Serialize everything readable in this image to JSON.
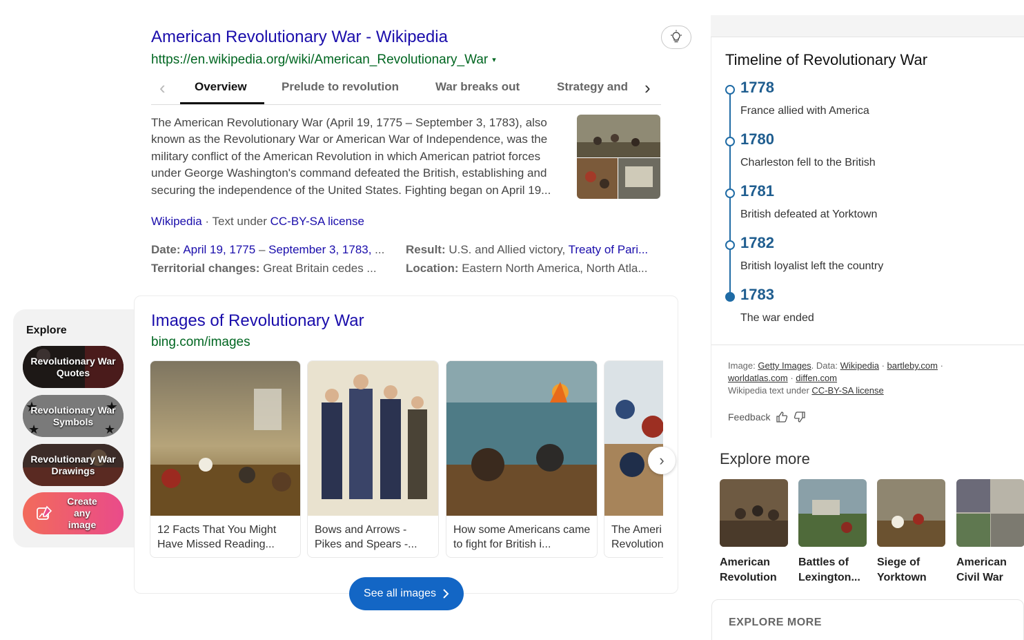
{
  "result": {
    "title": "American Revolutionary War - Wikipedia",
    "url": "https://en.wikipedia.org/wiki/American_Revolutionary_War",
    "url_caret": "▾",
    "tabs": [
      "Overview",
      "Prelude to revolution",
      "War breaks out",
      "Strategy and"
    ],
    "active_tab": "Overview",
    "summary": "The American Revolutionary War (April 19, 1775 – September 3, 1783), also known as the Revolutionary War or American War of Independence, was the military conflict of the American Revolution in which American patriot forces under George Washington's command defeated the British, establishing and securing the independence of the United States. Fighting began on April 19...",
    "source_name": "Wikipedia",
    "source_sep": " · Text under ",
    "license": "CC-BY-SA license",
    "facts": {
      "date_label": "Date:",
      "date_start": "April 19, 1775",
      "date_dash": " – ",
      "date_end": "September 3, 1783,",
      "date_more": " ...",
      "result_label": "Result:",
      "result_text": " U.S. and Allied victory, ",
      "result_link": "Treaty of Pari...",
      "territorial_label": "Territorial changes:",
      "territorial_text": " Great Britain cedes ...",
      "location_label": "Location:",
      "location_text": " Eastern North America, North Atla..."
    }
  },
  "images": {
    "title": "Images of Revolutionary War",
    "source": "bing.com/images",
    "items": [
      {
        "caption": "12 Facts That You Might Have Missed Reading..."
      },
      {
        "caption": "Bows and Arrows - Pikes and Spears -..."
      },
      {
        "caption": "How some Americans came to fight for British i..."
      },
      {
        "caption": "The Ameri Revolution"
      }
    ],
    "see_all": "See all images",
    "next_glyph": "›"
  },
  "explore": {
    "label": "Explore",
    "pills": [
      {
        "label": "Revolutionary War Quotes"
      },
      {
        "label": "Revolutionary War Symbols"
      },
      {
        "label": "Revolutionary War Drawings"
      },
      {
        "label": "Create any image"
      }
    ]
  },
  "timeline": {
    "title": "Timeline of Revolutionary War",
    "events": [
      {
        "year": "1778",
        "text": "France allied with America"
      },
      {
        "year": "1780",
        "text": "Charleston fell to the British"
      },
      {
        "year": "1781",
        "text": "British defeated at Yorktown"
      },
      {
        "year": "1782",
        "text": "British loyalist left the country"
      },
      {
        "year": "1783",
        "text": "The war ended"
      }
    ],
    "attrib": {
      "image_label": "Image: ",
      "image_src": "Getty Images",
      "data_label": ". Data: ",
      "src1": "Wikipedia",
      "sep": " · ",
      "src2": "bartleby.com",
      "src3": "worldatlas.com",
      "src4": "diffen.com",
      "wiki_text": "Wikipedia text under ",
      "license": "CC-BY-SA license"
    },
    "feedback": "Feedback"
  },
  "explore_more": {
    "title": "Explore more",
    "items": [
      {
        "label": "American Revolution"
      },
      {
        "label": "Battles of Lexington..."
      },
      {
        "label": "Siege of Yorktown"
      },
      {
        "label": "American Civil War"
      }
    ],
    "section_caps": "EXPLORE MORE"
  },
  "colors": {
    "link": "#1a0dab",
    "url_green": "#006621",
    "accent_blue": "#1366c5",
    "timeline_blue": "#1f6ba5"
  }
}
